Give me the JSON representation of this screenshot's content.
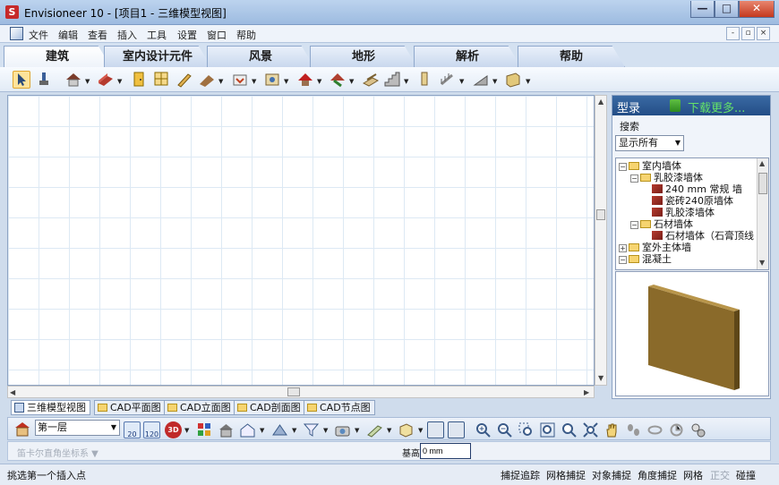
{
  "window": {
    "title": "Envisioneer 10 - [项目1 - 三维模型视图]",
    "logo_text": "S",
    "minimize": "—",
    "maximize": "□",
    "close": "✕"
  },
  "menu": [
    "文件",
    "编辑",
    "查看",
    "插入",
    "工具",
    "设置",
    "窗口",
    "帮助"
  ],
  "mdi_buttons": [
    "-",
    "▫",
    "×"
  ],
  "ribbon_tabs": [
    "建筑",
    "室内设计元件",
    "风景",
    "地形",
    "解析",
    "帮助"
  ],
  "active_tab": "建筑",
  "view_tabs": [
    "三维模型视图",
    "CAD平面图",
    "CAD立面图",
    "CAD剖面图",
    "CAD节点图"
  ],
  "active_view": "三维模型视图",
  "catalog": {
    "title": "型录",
    "download": "下载更多...",
    "search_label": "搜索",
    "filter": "显示所有",
    "tree": [
      {
        "label": "室内墙体",
        "level": 0,
        "type": "folder",
        "expander": "−"
      },
      {
        "label": "乳胶漆墙体",
        "level": 1,
        "type": "folder",
        "expander": "−"
      },
      {
        "label": "240 mm 常规 墙",
        "level": 2,
        "type": "wall"
      },
      {
        "label": "瓷砖240原墙体",
        "level": 2,
        "type": "wall"
      },
      {
        "label": "乳胶漆墙体",
        "level": 2,
        "type": "wall"
      },
      {
        "label": "石材墙体",
        "level": 1,
        "type": "folder",
        "expander": "−"
      },
      {
        "label": "石材墙体（石膏顶线",
        "level": 2,
        "type": "wall"
      },
      {
        "label": "室外主体墙",
        "level": 0,
        "type": "folder",
        "expander": "+"
      },
      {
        "label": "混凝土",
        "level": 0,
        "type": "folder",
        "expander": "−"
      }
    ]
  },
  "floor": "第一层",
  "bottom_tools": {
    "scale1": "20",
    "scale2": "120",
    "view3d": "3D"
  },
  "coord": {
    "system": "笛卡尔直角坐标系 ▼",
    "base_label": "基高",
    "base_value": "0 mm"
  },
  "status": {
    "message": "挑选第一个插入点",
    "snaps": [
      "捕捉追踪",
      "网格捕捉",
      "对象捕捉",
      "角度捕捉",
      "网格",
      "正交",
      "碰撞"
    ],
    "snaps_off": [
      "正交"
    ]
  },
  "colors": {
    "accent": "#234d86",
    "download": "#64e26a",
    "wall_preview": "#8a6a2a"
  }
}
